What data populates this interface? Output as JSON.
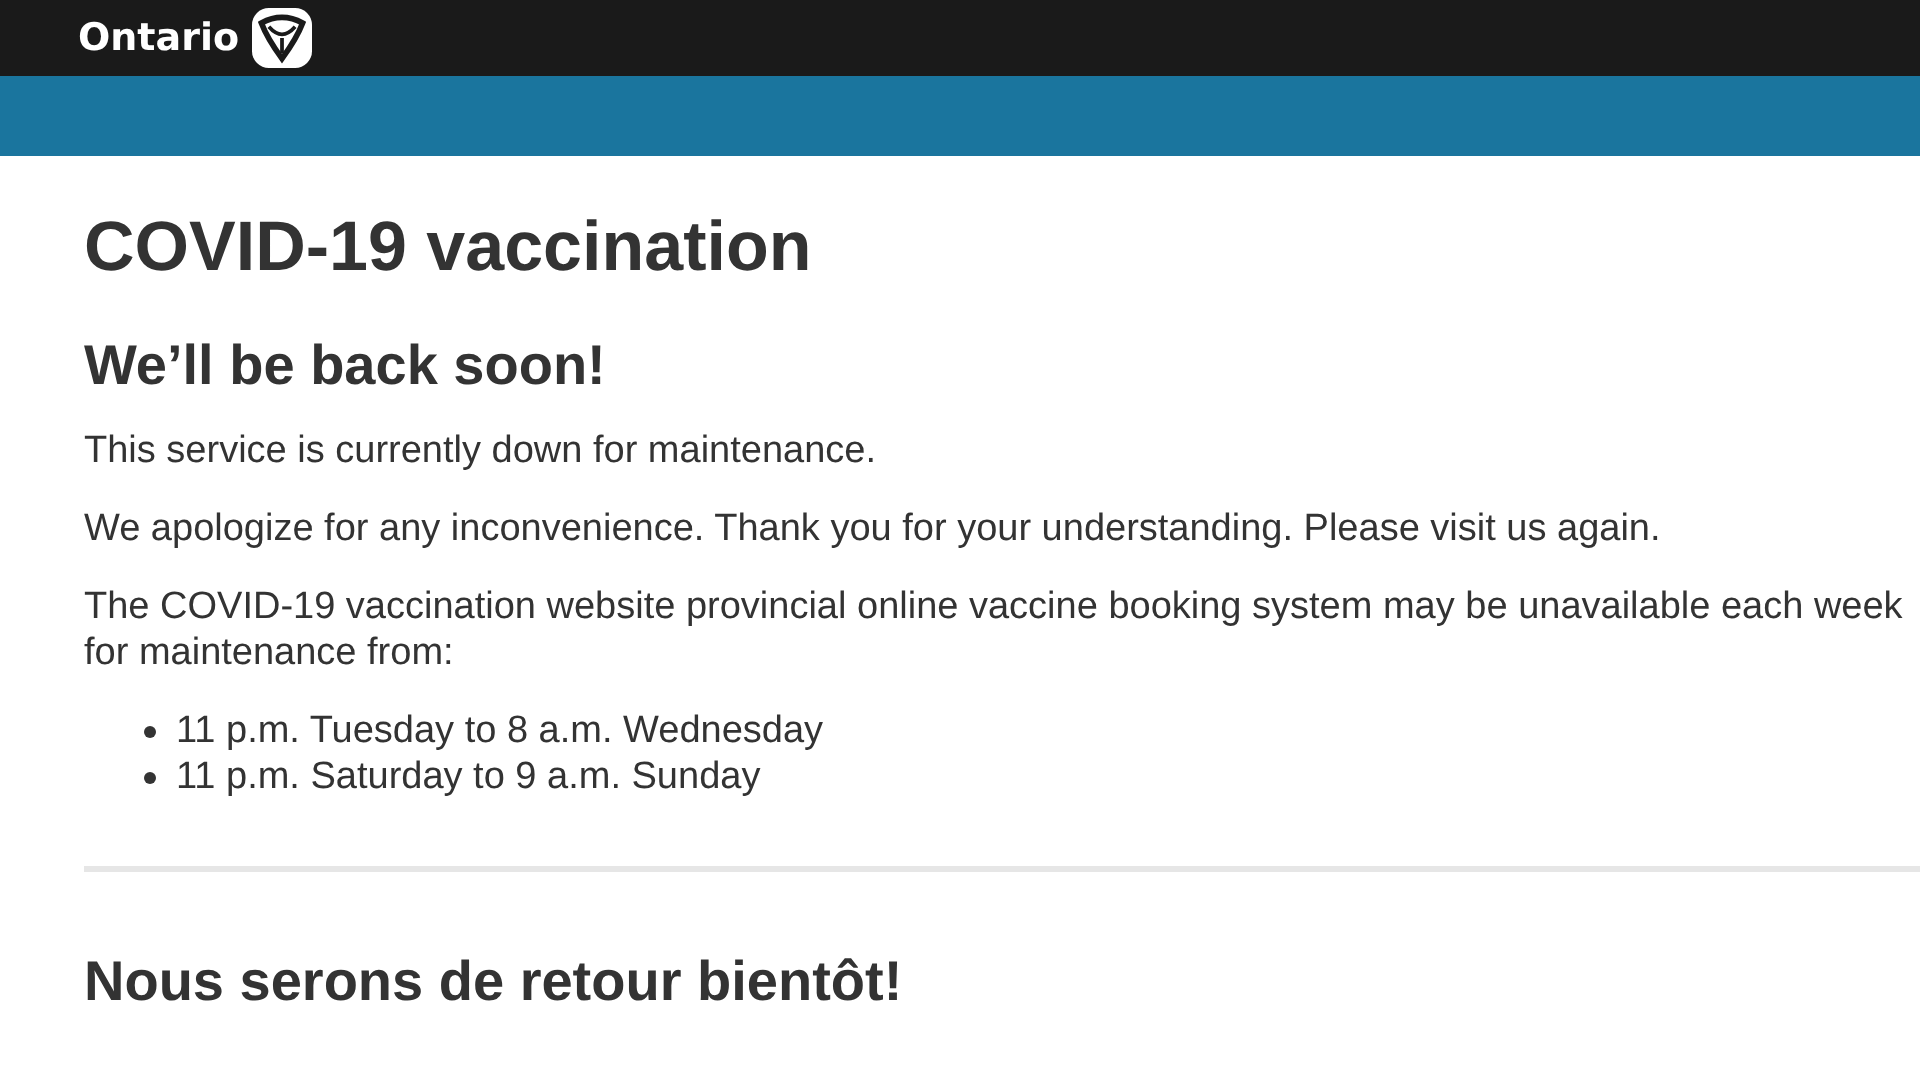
{
  "header": {
    "logo_text": "Ontario"
  },
  "title": "COVID-19 vaccination",
  "english": {
    "heading": "We’ll be back soon!",
    "paragraphs": [
      "This service is currently down for maintenance.",
      "We apologize for any inconvenience. Thank you for your understanding. Please visit us again.",
      "The COVID-19 vaccination website provincial online vaccine booking system may be unavailable each week for maintenance from:"
    ],
    "schedule": [
      "11 p.m. Tuesday to 8 a.m. Wednesday",
      "11 p.m. Saturday to 9 a.m. Sunday"
    ]
  },
  "french": {
    "heading": "Nous serons de retour bientôt!"
  }
}
